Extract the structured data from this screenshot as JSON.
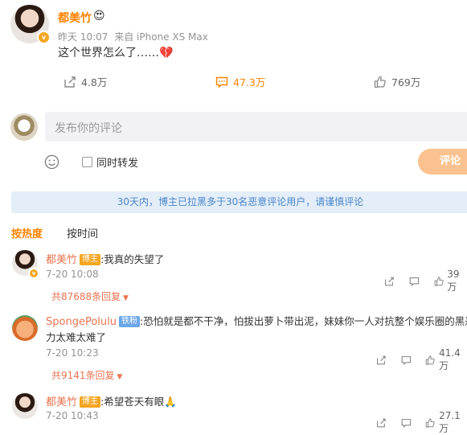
{
  "post": {
    "username": "都美竹",
    "time": "昨天 10:07",
    "source": "来自 iPhone XS Max",
    "content": "这个世界怎么了……",
    "emoji": "💔",
    "actions": {
      "repost": "4.8万",
      "comment": "47.3万",
      "like": "769万"
    }
  },
  "composer": {
    "placeholder": "发布你的评论",
    "also_repost": "同时转发",
    "submit": "评论"
  },
  "notice": "30天内，博主已拉黑多于30名恶意评论用户，请谨慎评论",
  "sort_tabs": [
    "按热度",
    "按时间"
  ],
  "comments": [
    {
      "username": "都美竹",
      "tag": "博主",
      "text": ":我真的失望了",
      "time": "7-20 10:08",
      "like": "39万",
      "replies": "共87688条回复"
    },
    {
      "username": "SpongePolulu",
      "tag": "铁粉",
      "text": ":恐怕就是都不干净，怕拔出萝卜带出泥，妹妹你一人对抗整个娱乐圈的黑恶势力太难太难了",
      "time": "7-20 10:23",
      "like": "41.4万",
      "replies": "共9141条回复"
    },
    {
      "username": "都美竹",
      "tag": "博主",
      "text": ":希望苍天有眼🙏",
      "time": "7-20 10:43",
      "like": "27.1万",
      "replies": ""
    }
  ],
  "colors": {
    "username": "#ff8200",
    "comment_name": "#eb7350",
    "notice_bg": "#e4eef9",
    "submit_bg": "#fbc28f"
  }
}
